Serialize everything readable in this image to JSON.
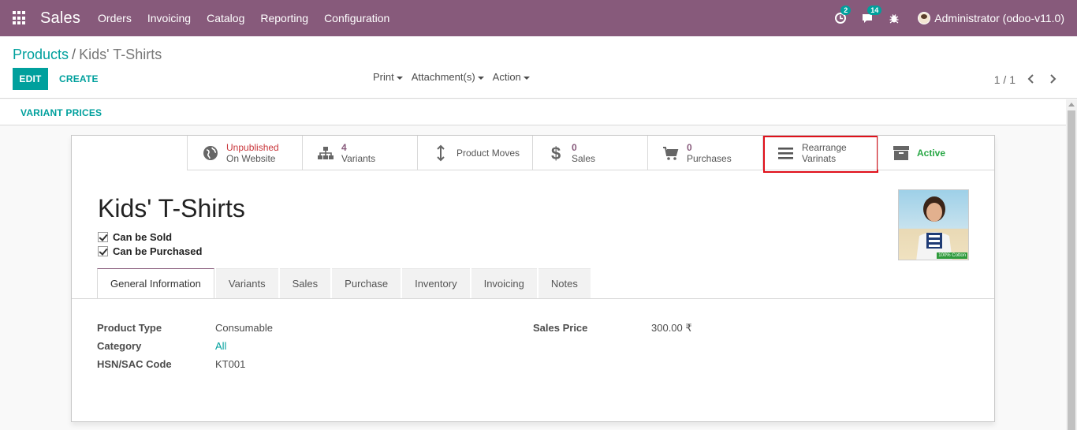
{
  "navbar": {
    "app_name": "Sales",
    "menus": [
      "Orders",
      "Invoicing",
      "Catalog",
      "Reporting",
      "Configuration"
    ],
    "activity_count": "2",
    "messages_count": "14",
    "user_label": "Administrator (odoo-v11.0)",
    "bg_color": "#875a7b"
  },
  "breadcrumb": {
    "parent": "Products",
    "separator": "/",
    "current": "Kids' T-Shirts"
  },
  "toolbar": {
    "edit_label": "EDIT",
    "create_label": "CREATE",
    "print_label": "Print",
    "attachments_label": "Attachment(s)",
    "action_label": "Action",
    "pager_text": "1 / 1"
  },
  "statusbar": {
    "variant_prices_label": "VARIANT PRICES"
  },
  "smart_buttons": {
    "website": {
      "line1": "Unpublished",
      "line2": "On Website",
      "icon": "globe-icon"
    },
    "variants": {
      "line1": "4",
      "line2": "Variants",
      "icon": "sitemap-icon"
    },
    "moves": {
      "line1": "Product Moves",
      "icon": "arrows-v-icon"
    },
    "sales": {
      "line1": "0",
      "line2": "Sales",
      "icon": "dollar-icon"
    },
    "purchases": {
      "line1": "0",
      "line2": "Purchases",
      "icon": "cart-icon"
    },
    "rearrange": {
      "line1": "Rearrange",
      "line2": "Varinats",
      "icon": "bars-icon"
    },
    "active": {
      "line1": "Active",
      "icon": "archive-icon"
    }
  },
  "product": {
    "name": "Kids' T-Shirts",
    "can_be_sold_label": "Can be Sold",
    "can_be_purchased_label": "Can be Purchased",
    "image_label": "100% Cotton"
  },
  "tabs": [
    "General Information",
    "Variants",
    "Sales",
    "Purchase",
    "Inventory",
    "Invoicing",
    "Notes"
  ],
  "fields": {
    "product_type_label": "Product Type",
    "product_type_value": "Consumable",
    "category_label": "Category",
    "category_value": "All",
    "hsn_label": "HSN/SAC Code",
    "hsn_value": "KT001",
    "sales_price_label": "Sales Price",
    "sales_price_value": "300.00 ₹"
  },
  "colors": {
    "accent": "#00a09d",
    "brand": "#875a7b",
    "highlight": "#e0101a"
  }
}
